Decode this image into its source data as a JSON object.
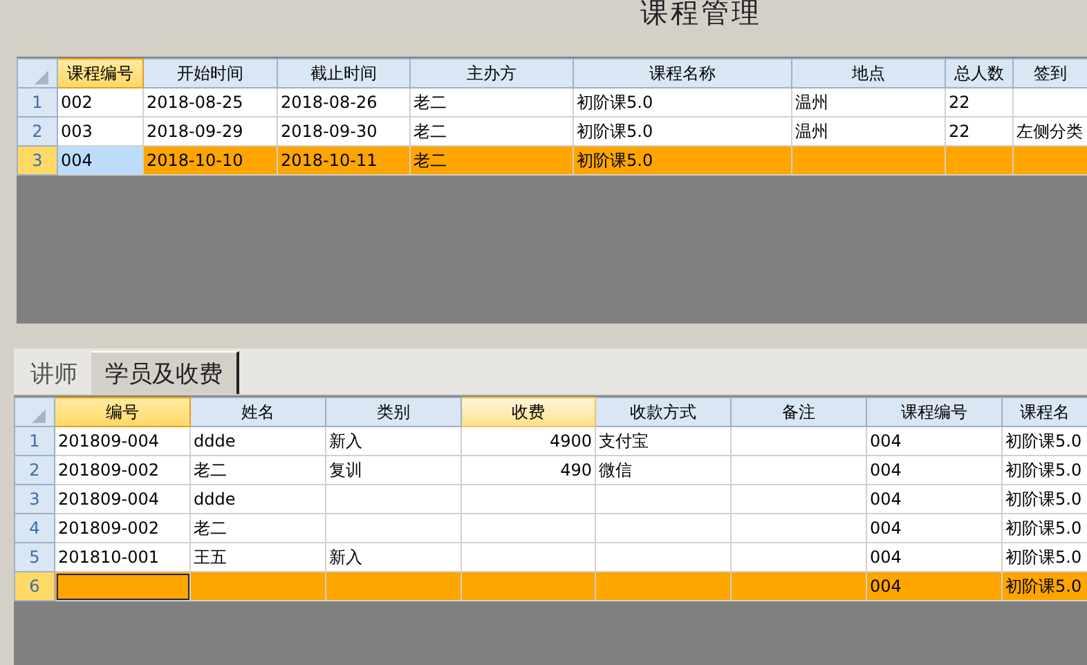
{
  "title": "课程管理",
  "course_grid": {
    "focused": false,
    "columns": [
      {
        "label": "课程编号",
        "selected": true,
        "hovered": false,
        "kind": "text"
      },
      {
        "label": "开始时间",
        "selected": false,
        "hovered": false,
        "kind": "text"
      },
      {
        "label": "截止时间",
        "selected": false,
        "hovered": false,
        "kind": "text"
      },
      {
        "label": "主办方",
        "selected": false,
        "hovered": false,
        "kind": "text"
      },
      {
        "label": "课程名称",
        "selected": false,
        "hovered": false,
        "kind": "text"
      },
      {
        "label": "地点",
        "selected": false,
        "hovered": false,
        "kind": "text"
      },
      {
        "label": "总人数",
        "selected": false,
        "hovered": false,
        "kind": "text"
      },
      {
        "label": "签到",
        "selected": false,
        "hovered": false,
        "kind": "text"
      }
    ],
    "rows": [
      {
        "number": "1",
        "selected": false,
        "cells": [
          "002",
          "2018-08-25",
          "2018-08-26",
          "老二",
          "初阶课5.0",
          "温州",
          "22",
          ""
        ]
      },
      {
        "number": "2",
        "selected": false,
        "cells": [
          "003",
          "2018-09-29",
          "2018-09-30",
          "老二",
          "初阶课5.0",
          "温州",
          "22",
          "左侧分类"
        ]
      },
      {
        "number": "3",
        "selected": true,
        "cells": [
          "004",
          "2018-10-10",
          "2018-10-11",
          "老二",
          "初阶课5.0",
          "",
          "",
          ""
        ]
      }
    ]
  },
  "tabs": [
    {
      "label": "讲师",
      "selected": false
    },
    {
      "label": "学员及收费",
      "selected": true
    }
  ],
  "student_grid": {
    "focused": true,
    "columns": [
      {
        "label": "编号",
        "selected": true,
        "hovered": false,
        "kind": "text"
      },
      {
        "label": "姓名",
        "selected": false,
        "hovered": false,
        "kind": "text"
      },
      {
        "label": "类别",
        "selected": false,
        "hovered": false,
        "kind": "text"
      },
      {
        "label": "收费",
        "selected": false,
        "hovered": true,
        "kind": "number"
      },
      {
        "label": "收款方式",
        "selected": false,
        "hovered": false,
        "kind": "text"
      },
      {
        "label": "备注",
        "selected": false,
        "hovered": false,
        "kind": "text"
      },
      {
        "label": "课程编号",
        "selected": false,
        "hovered": false,
        "kind": "text"
      },
      {
        "label": "课程名",
        "selected": false,
        "hovered": false,
        "kind": "text"
      }
    ],
    "rows": [
      {
        "number": "1",
        "selected": false,
        "cells": [
          "201809-004",
          "ddde",
          "新入",
          "4900",
          "支付宝",
          "",
          "004",
          "初阶课5.0"
        ]
      },
      {
        "number": "2",
        "selected": false,
        "cells": [
          "201809-002",
          "老二",
          "复训",
          "490",
          "微信",
          "",
          "004",
          "初阶课5.0"
        ]
      },
      {
        "number": "3",
        "selected": false,
        "cells": [
          "201809-004",
          "ddde",
          "",
          "",
          "",
          "",
          "004",
          "初阶课5.0"
        ]
      },
      {
        "number": "4",
        "selected": false,
        "cells": [
          "201809-002",
          "老二",
          "",
          "",
          "",
          "",
          "004",
          "初阶课5.0"
        ]
      },
      {
        "number": "5",
        "selected": false,
        "cells": [
          "201810-001",
          "王五",
          "新入",
          "",
          "",
          "",
          "004",
          "初阶课5.0"
        ]
      },
      {
        "number": "6",
        "selected": true,
        "cells": [
          "",
          "",
          "",
          "",
          "",
          "",
          "004",
          "初阶课5.0"
        ]
      }
    ]
  }
}
